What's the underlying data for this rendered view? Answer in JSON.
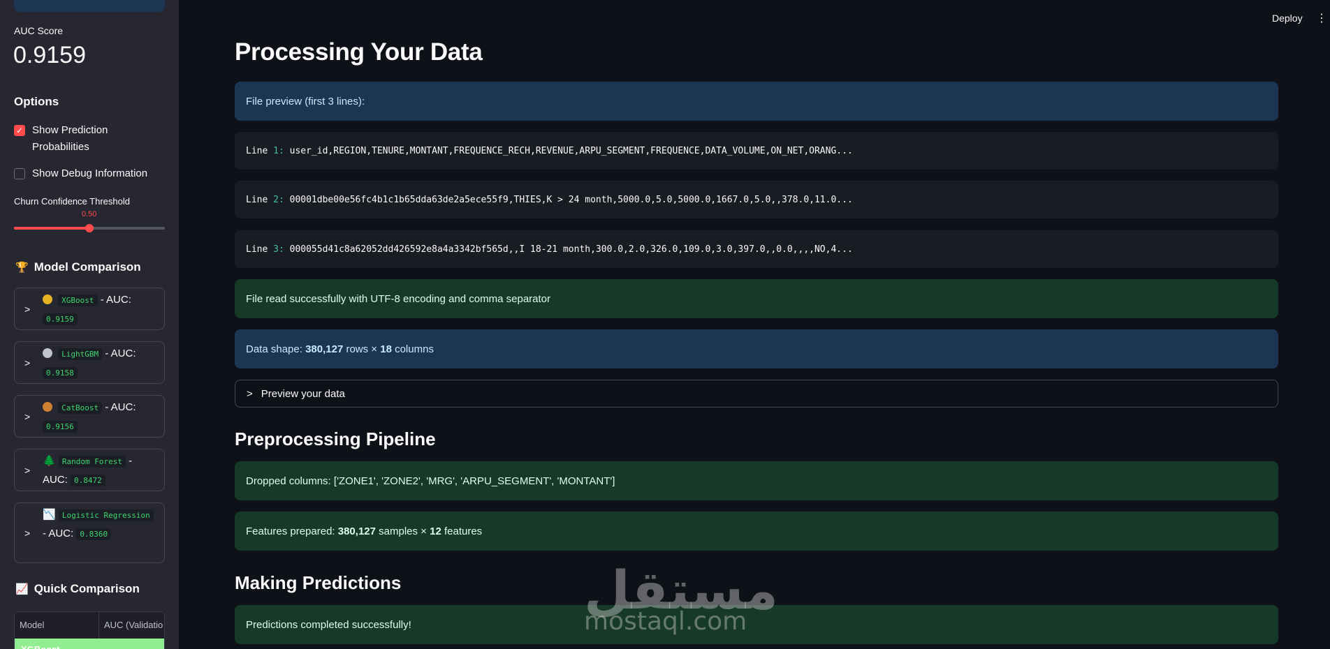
{
  "sidebar": {
    "auc_label": "AUC Score",
    "auc_value": "0.9159",
    "options_title": "Options",
    "checkbox_prob": {
      "label": "Show Prediction Probabilities",
      "checked": true
    },
    "checkbox_debug": {
      "label": "Show Debug Information",
      "checked": false
    },
    "slider": {
      "label": "Churn Confidence Threshold",
      "value": "0.50",
      "fraction": 0.5
    },
    "model_comparison_title": "Model Comparison",
    "models": [
      {
        "name": "XGBoost",
        "suffix": " - AUC:",
        "auc": "0.9159",
        "icon": "gold-medal-icon"
      },
      {
        "name": "LightGBM",
        "suffix": " - AUC:",
        "auc": "0.9158",
        "icon": "silver-medal-icon"
      },
      {
        "name": "CatBoost",
        "suffix": " - AUC:",
        "auc": "0.9156",
        "icon": "bronze-medal-icon"
      },
      {
        "name": "Random Forest",
        "suffix": " - AUC:",
        "auc": "0.8472",
        "icon": "tree-icon"
      },
      {
        "name": "Logistic Regression",
        "suffix": " - AUC:",
        "auc": "0.8360",
        "icon": "chart-down-icon"
      }
    ],
    "quick_comparison_title": "Quick Comparison",
    "quick_table": {
      "headers": [
        "Model",
        "AUC (Validatio"
      ],
      "first_row": "XGBoost"
    },
    "colors": {
      "accent": "#ff4b4b",
      "code_green": "#3dd56d",
      "highlight_row": "#90ee90"
    }
  },
  "topbar": {
    "deploy_label": "Deploy",
    "menu_icon": "kebab-menu-icon"
  },
  "main": {
    "title": "Processing Your Data",
    "file_preview_info": "File preview (first 3 lines):",
    "lines": [
      {
        "label": "Line ",
        "num": "1:",
        "text": " user_id,REGION,TENURE,MONTANT,FREQUENCE_RECH,REVENUE,ARPU_SEGMENT,FREQUENCE,DATA_VOLUME,ON_NET,ORANG..."
      },
      {
        "label": "Line ",
        "num": "2:",
        "text": " 00001dbe00e56fc4b1c1b65dda63de2a5ece55f9,THIES,K > 24 month,5000.0,5.0,5000.0,1667.0,5.0,,378.0,11.0..."
      },
      {
        "label": "Line ",
        "num": "3:",
        "text": " 000055d41c8a62052dd426592e8a4a3342bf565d,,I 18-21 month,300.0,2.0,326.0,109.0,3.0,397.0,,0.0,,,,NO,4..."
      }
    ],
    "read_success": "File read successfully with UTF-8 encoding and comma separator",
    "shape_prefix": "Data shape: ",
    "shape_rows": "380,127",
    "shape_mid": " rows × ",
    "shape_cols": "18",
    "shape_suffix": " columns",
    "preview_expander": "Preview your data",
    "preprocessing_title": "Preprocessing Pipeline",
    "dropped_columns": "Dropped columns: ['ZONE1', 'ZONE2', 'MRG', 'ARPU_SEGMENT', 'MONTANT']",
    "features_prefix": "Features prepared: ",
    "features_samples": "380,127",
    "features_mid": " samples × ",
    "features_count": "12",
    "features_suffix": " features",
    "predictions_title": "Making Predictions",
    "predictions_success": "Predictions completed successfully!"
  },
  "watermark": {
    "arabic": "مستقل",
    "latin": "mostaql.com"
  }
}
